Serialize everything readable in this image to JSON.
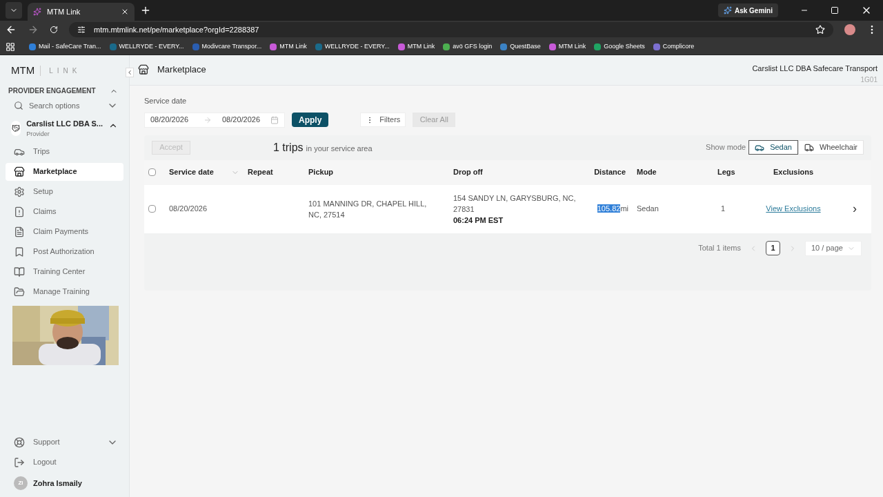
{
  "browser": {
    "tabs": [
      {
        "title": "MTM Link",
        "selected": true
      }
    ],
    "ask_button": "Ask Gemini",
    "url": "mtm.mtmlink.net/pe/marketplace?orgId=2288387",
    "bookmarks": [
      {
        "label": "Mail - SafeCare Tran...",
        "color": "#2f7fd8"
      },
      {
        "label": "WELLRYDE - EVERY...",
        "color": "#1a6a8a"
      },
      {
        "label": "Modivcare Transpor...",
        "color": "#2a5db0"
      },
      {
        "label": "MTM Link",
        "color": "#c85ad8"
      },
      {
        "label": "WELLRYDE - EVERY...",
        "color": "#1a6a8a"
      },
      {
        "label": "MTM Link",
        "color": "#c85ad8"
      },
      {
        "label": "avö GFS login",
        "color": "#4caf50"
      },
      {
        "label": "QuestBase",
        "color": "#3b82c4"
      },
      {
        "label": "MTM Link",
        "color": "#c85ad8"
      },
      {
        "label": "Google Sheets",
        "color": "#1fa463"
      },
      {
        "label": "Complicore",
        "color": "#7c6fd0"
      }
    ]
  },
  "sidebar": {
    "logo": "MTM",
    "logo_suffix": "LINK",
    "section": "PROVIDER ENGAGEMENT",
    "search": "Search options",
    "provider": {
      "name": "Carslist LLC DBA S...",
      "role": "Provider",
      "expanded": true
    },
    "items": [
      {
        "label": "Trips",
        "kind": "car",
        "selected": false
      },
      {
        "label": "Marketplace",
        "kind": "store",
        "selected": true
      },
      {
        "label": "Setup",
        "kind": "gear",
        "selected": false
      },
      {
        "label": "Claims",
        "kind": "alert",
        "selected": false
      },
      {
        "label": "Claim Payments",
        "kind": "dollar",
        "selected": false
      },
      {
        "label": "Post Authorization",
        "kind": "bookmark",
        "selected": false
      },
      {
        "label": "Training Center",
        "kind": "book",
        "selected": false
      },
      {
        "label": "Manage Training",
        "kind": "folder",
        "selected": false
      }
    ],
    "bottom": [
      {
        "label": "Support",
        "kind": "lifebuoy",
        "expandable": true
      },
      {
        "label": "Logout",
        "kind": "logout",
        "expandable": false
      }
    ],
    "user": {
      "initials": "ZI",
      "name": "Zohra Ismaily"
    }
  },
  "header": {
    "title": "Marketplace",
    "org": "Carslist LLC DBA Safecare Transport",
    "code": "1G01"
  },
  "filters": {
    "label": "Service date",
    "from": "08/20/2026",
    "to": "08/20/2026",
    "apply": "Apply",
    "filters": "Filters",
    "clear": "Clear All",
    "clear_disabled": true
  },
  "summary": {
    "accept": "Accept",
    "accept_disabled": true,
    "count": "1 trips",
    "suffix": "in your service area",
    "show_mode": "Show mode",
    "modes": [
      {
        "label": "Sedan",
        "kind": "car",
        "selected": true
      },
      {
        "label": "Wheelchair",
        "kind": "van",
        "selected": false
      }
    ]
  },
  "table": {
    "select_all_checked": false,
    "columns": [
      "Service date",
      "Repeat",
      "Pickup",
      "Drop off",
      "Distance",
      "Mode",
      "Legs",
      "Exclusions"
    ],
    "rows": [
      {
        "checked": false,
        "service_date": "08/20/2026",
        "pickup": "101 MANNING DR, CHAPEL HILL, NC, 27514",
        "dropoff": "154 SANDY LN, GARYSBURG, NC, 27831",
        "dropoff_time": "06:24 PM EST",
        "distance": "105.82",
        "distance_highlighted": true,
        "unit": "mi",
        "mode": "Sedan",
        "legs": "1",
        "exclusions": "View Exclusions",
        "chevron": "›"
      }
    ]
  },
  "pagination": {
    "total": "Total 1 items",
    "pages": [
      {
        "label": "1",
        "selected": true
      }
    ],
    "page_size": "10 / page"
  }
}
